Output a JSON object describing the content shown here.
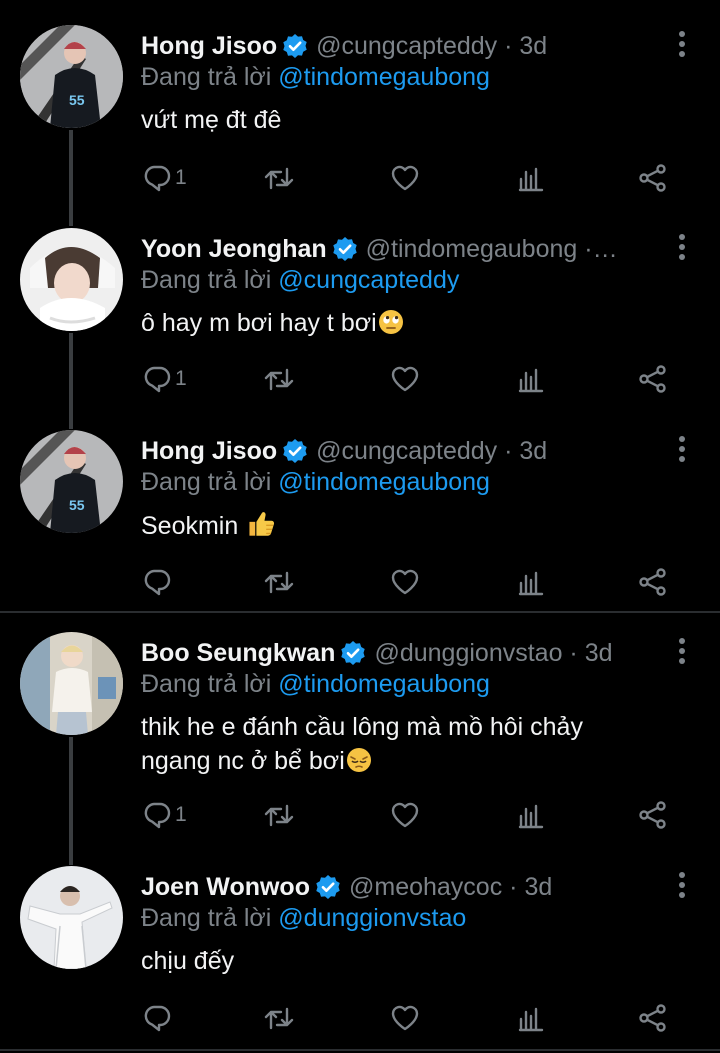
{
  "tweets": [
    {
      "name": "Hong Jisoo",
      "handle": "@cungcapteddy",
      "time": "3d",
      "reply_prefix": "Đang trả lời",
      "reply_to": "@tindomegaubong",
      "text": "vứt mẹ đt đê",
      "emoji": "",
      "reply_count": "1",
      "avatar": "avatar-1"
    },
    {
      "name": "Yoon Jeonghan",
      "handle": "@tindomegaubong",
      "time": "…",
      "reply_prefix": "Đang trả lời",
      "reply_to": "@cungcapteddy",
      "text": "ô hay m bơi hay t bơi",
      "emoji": "face-with-rolling-eyes",
      "reply_count": "1",
      "avatar": "avatar-2"
    },
    {
      "name": "Hong Jisoo",
      "handle": "@cungcapteddy",
      "time": "3d",
      "reply_prefix": "Đang trả lời",
      "reply_to": "@tindomegaubong",
      "text": "Seokmin",
      "emoji": "thumbs-up",
      "reply_count": "",
      "avatar": "avatar-1"
    },
    {
      "name": "Boo Seungkwan",
      "handle": "@dunggionvstao",
      "time": "3d",
      "reply_prefix": "Đang trả lời",
      "reply_to": "@tindomegaubong",
      "text_lines": [
        "thik he e đánh cầu lông mà mồ hôi chảy",
        "ngang nc ở bể bơi"
      ],
      "emoji": "pensive-face",
      "reply_count": "1",
      "avatar": "avatar-3"
    },
    {
      "name": "Joen Wonwoo",
      "handle": "@meohaycoc",
      "time": "3d",
      "reply_prefix": "Đang trả lời",
      "reply_to": "@dunggionvstao",
      "text": "chịu đếy",
      "emoji": "",
      "reply_count": "",
      "avatar": "avatar-4"
    }
  ],
  "icons": {
    "reply": "reply-icon",
    "retweet": "retweet-icon",
    "like": "heart-icon",
    "views": "analytics-icon",
    "share": "share-icon",
    "verified": "verified-badge-icon",
    "more": "more-vertical-icon"
  },
  "colors": {
    "background": "#000000",
    "text": "#e7e9ea",
    "muted": "#7d8389",
    "link": "#1d9bf0",
    "verified": "#1d9bf0"
  }
}
